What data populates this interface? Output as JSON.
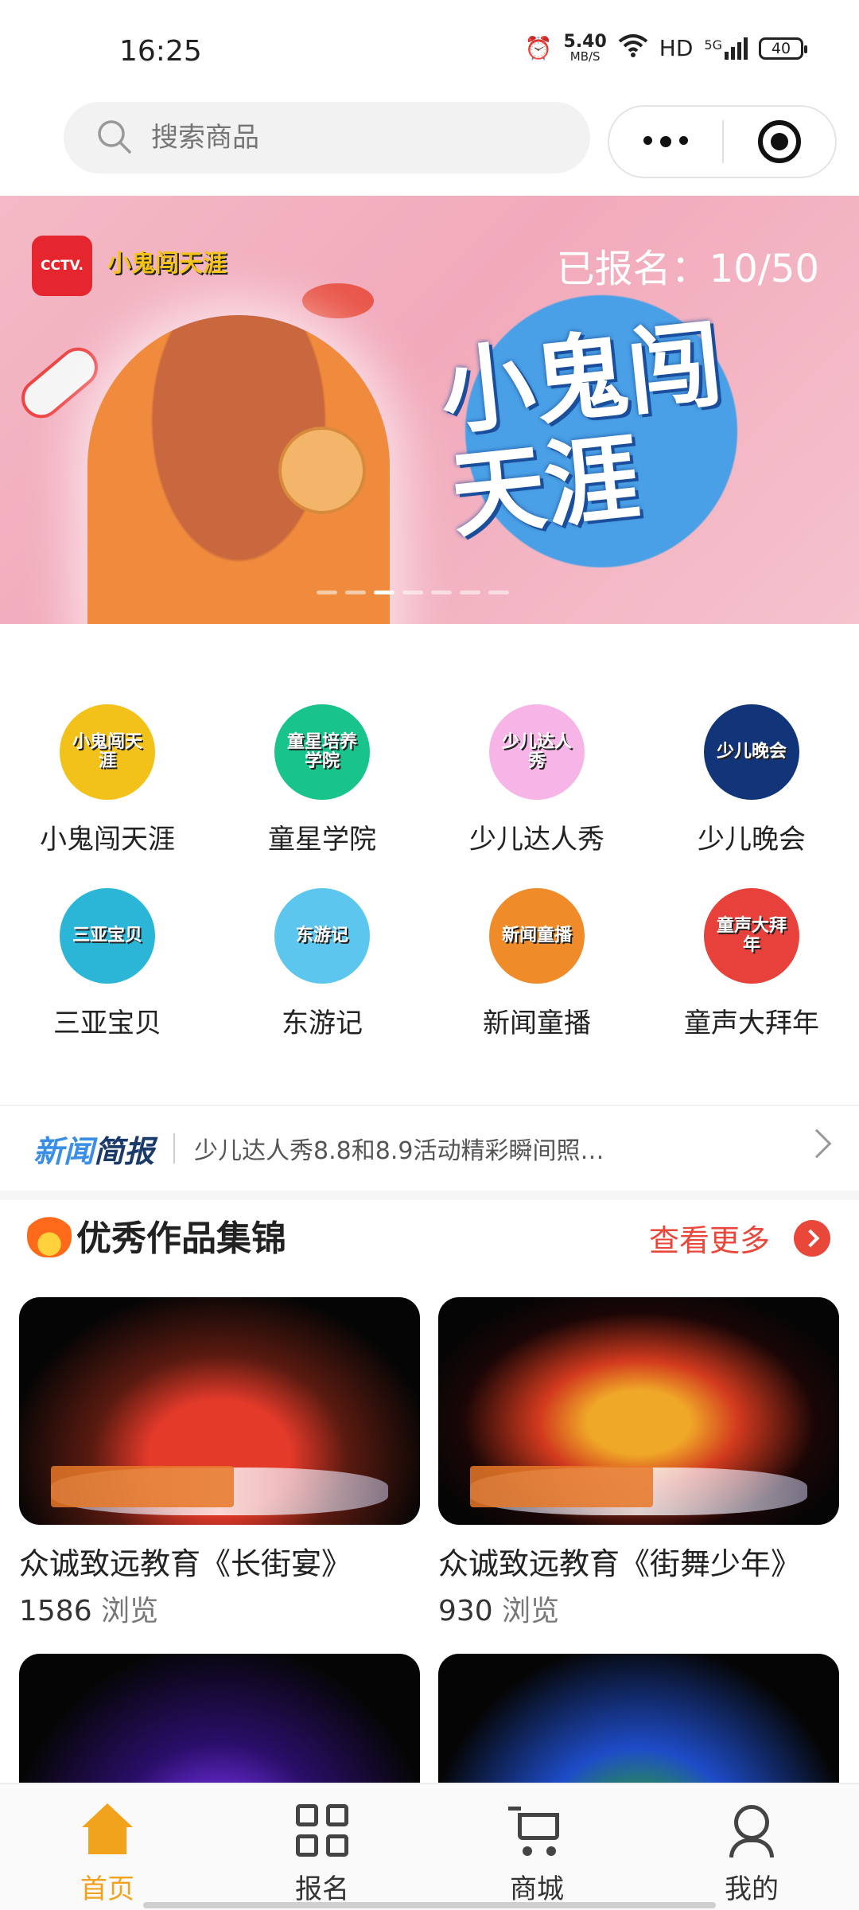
{
  "status_bar": {
    "time": "16:25",
    "net_speed_value": "5.40",
    "net_speed_unit": "MB/S",
    "hd": "HD",
    "signal": "5G",
    "battery": "40"
  },
  "search": {
    "placeholder": "搜索商品"
  },
  "banner": {
    "channel_logo": "CCTV.",
    "brand_logo": "小鬼闯天涯",
    "title": "小鬼闯天涯",
    "enrolled": "已报名：10/50",
    "slide_count": 7,
    "active_slide": 2
  },
  "categories": [
    {
      "label": "小鬼闯天涯",
      "badge": "小鬼闯天涯",
      "color": "#f2c21b"
    },
    {
      "label": "童星学院",
      "badge": "童星培养学院",
      "color": "#18c48c"
    },
    {
      "label": "少儿达人秀",
      "badge": "少儿达人秀",
      "color": "#f6b5e6"
    },
    {
      "label": "少儿晚会",
      "badge": "少儿晚会",
      "color": "#12357a"
    },
    {
      "label": "三亚宝贝",
      "badge": "三亚宝贝",
      "color": "#2bb6d8"
    },
    {
      "label": "东游记",
      "badge": "东游记",
      "color": "#5cc6ef"
    },
    {
      "label": "新闻童播",
      "badge": "新闻童播",
      "color": "#f08b2a"
    },
    {
      "label": "童声大拜年",
      "badge": "童声大拜年",
      "color": "#e8403a"
    }
  ],
  "news": {
    "tag_part1": "新闻",
    "tag_part2": "简报",
    "headline": "少儿达人秀8.8和8.9活动精彩瞬间照…"
  },
  "section": {
    "title": "优秀作品集锦",
    "see_more": "查看更多"
  },
  "works": [
    {
      "title": "众诚致远教育《长街宴》",
      "views": "1586",
      "views_suffix": " 浏览"
    },
    {
      "title": "众诚致远教育《街舞少年》",
      "views": "930",
      "views_suffix": " 浏览"
    }
  ],
  "tabs": [
    {
      "label": "首页",
      "icon": "home-icon",
      "active": true
    },
    {
      "label": "报名",
      "icon": "grid-icon",
      "active": false
    },
    {
      "label": "商城",
      "icon": "cart-icon",
      "active": false
    },
    {
      "label": "我的",
      "icon": "user-icon",
      "active": false
    }
  ],
  "colors": {
    "accent": "#f2a31e",
    "see_more": "#e8473a",
    "news_tag": "#3a8ee6"
  }
}
